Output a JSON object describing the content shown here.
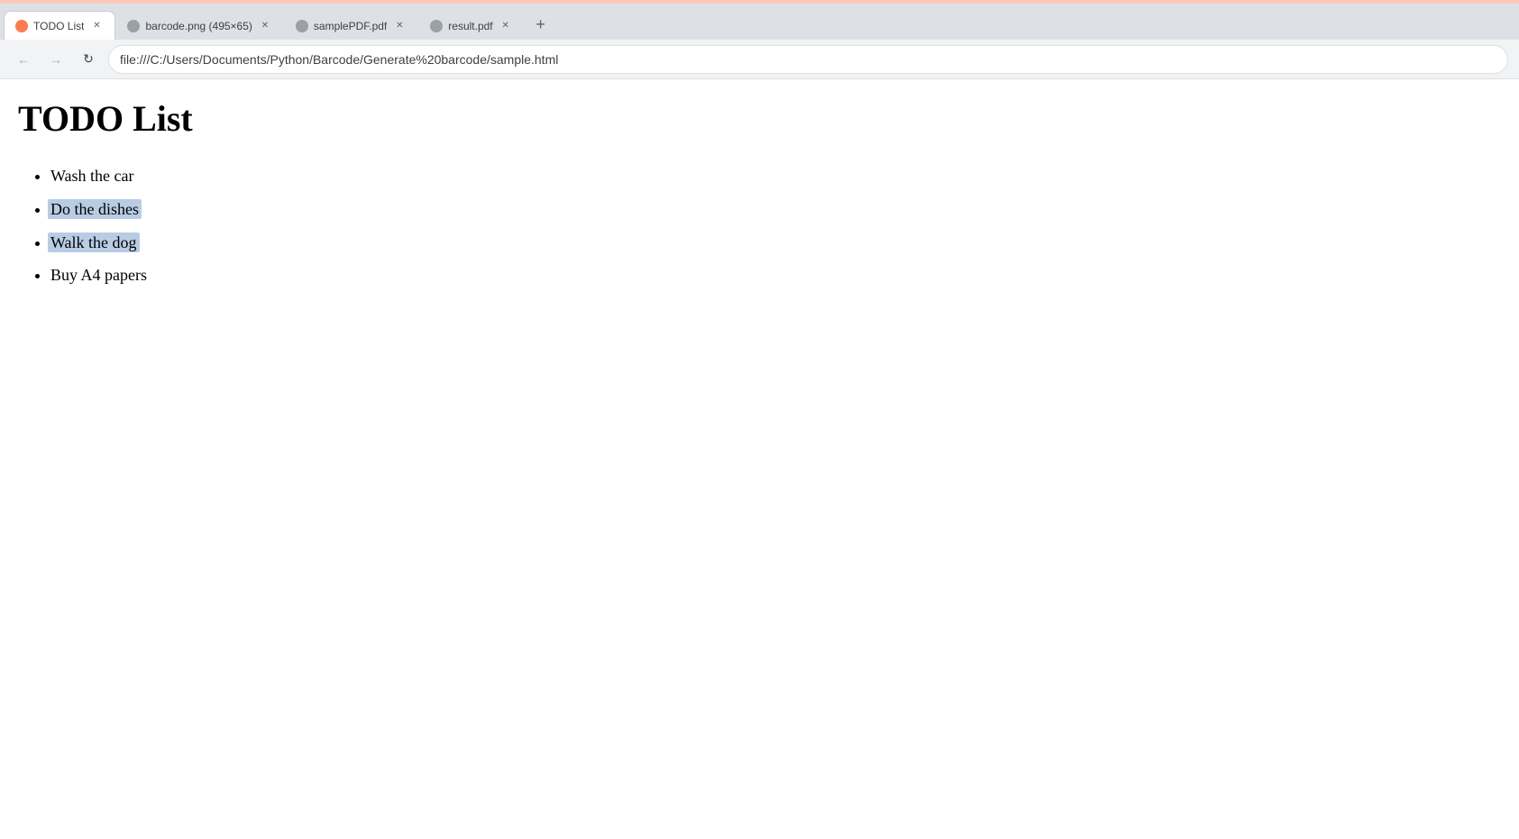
{
  "browser": {
    "top_gradient_color": "#f9c8b8",
    "tabs": [
      {
        "id": "tab-todo",
        "label": "TODO List",
        "active": true,
        "favicon_color": "#fa7c4f",
        "favicon_type": "orange"
      },
      {
        "id": "tab-barcode",
        "label": "barcode.png (495×65)",
        "active": false,
        "favicon_color": "#9aa0a6",
        "favicon_type": "gray"
      },
      {
        "id": "tab-samplepdf",
        "label": "samplePDF.pdf",
        "active": false,
        "favicon_color": "#9aa0a6",
        "favicon_type": "gray"
      },
      {
        "id": "tab-result",
        "label": "result.pdf",
        "active": false,
        "favicon_color": "#9aa0a6",
        "favicon_type": "gray"
      }
    ],
    "new_tab_button": "+",
    "nav": {
      "back_label": "←",
      "forward_label": "→",
      "reload_label": "↻",
      "address": "file:///C:/Users/Documents/Python/Barcode/Generate%20barcode/sample.html"
    }
  },
  "page": {
    "title": "TODO List",
    "items": [
      {
        "id": "item-1",
        "text": "Wash the car",
        "selected": false
      },
      {
        "id": "item-2",
        "text": "Do the dishes",
        "selected": true
      },
      {
        "id": "item-3",
        "text": "Walk the dog",
        "selected": true
      },
      {
        "id": "item-4",
        "text": "Buy A4 papers",
        "selected": false
      }
    ]
  }
}
